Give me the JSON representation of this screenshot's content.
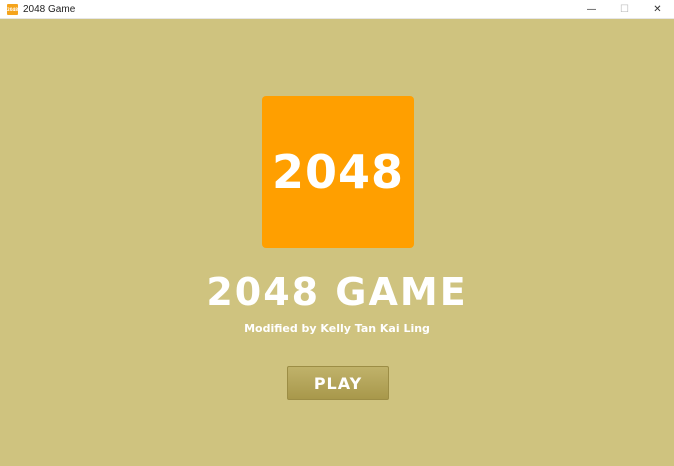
{
  "window": {
    "title": "2048 Game",
    "icon_text": "2048",
    "minimize_symbol": "—",
    "maximize_symbol": "☐",
    "close_symbol": "✕"
  },
  "logo": {
    "text": "2048",
    "color": "#ff9f00"
  },
  "main": {
    "title": "2048 GAME",
    "credit": "Modified by Kelly Tan Kai Ling",
    "play_label": "PLAY"
  },
  "colors": {
    "background": "#cfc37f",
    "button": "#b3a45a"
  }
}
